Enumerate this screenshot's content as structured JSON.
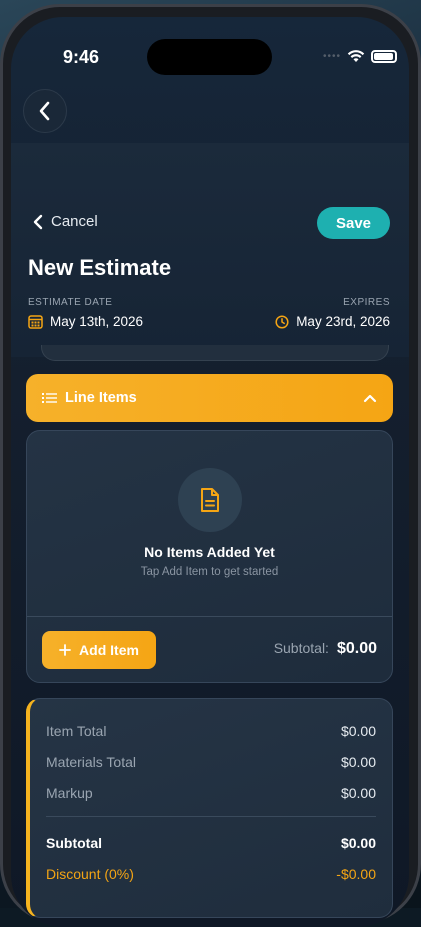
{
  "status_bar": {
    "time": "9:46"
  },
  "header": {
    "cancel_label": "Cancel",
    "save_label": "Save",
    "title": "New Estimate",
    "estimate_date_label": "ESTIMATE DATE",
    "estimate_date": "May 13th, 2026",
    "expires_label": "EXPIRES",
    "expires_date": "May 23rd, 2026"
  },
  "line_items": {
    "section_label": "Line Items",
    "empty_title": "No Items Added Yet",
    "empty_subtitle": "Tap Add Item to get started",
    "add_item_label": "Add Item",
    "subtotal_label": "Subtotal:",
    "subtotal_value": "$0.00"
  },
  "totals": {
    "rows": [
      {
        "label": "Item Total",
        "value": "$0.00"
      },
      {
        "label": "Materials Total",
        "value": "$0.00"
      },
      {
        "label": "Markup",
        "value": "$0.00"
      },
      {
        "label": "Subtotal",
        "value": "$0.00"
      },
      {
        "label": "Discount (0%)",
        "value": "-$0.00"
      }
    ]
  },
  "colors": {
    "accent_orange": "#f5a514",
    "save_teal": "#1eb0b0",
    "background": "#141f2e"
  }
}
